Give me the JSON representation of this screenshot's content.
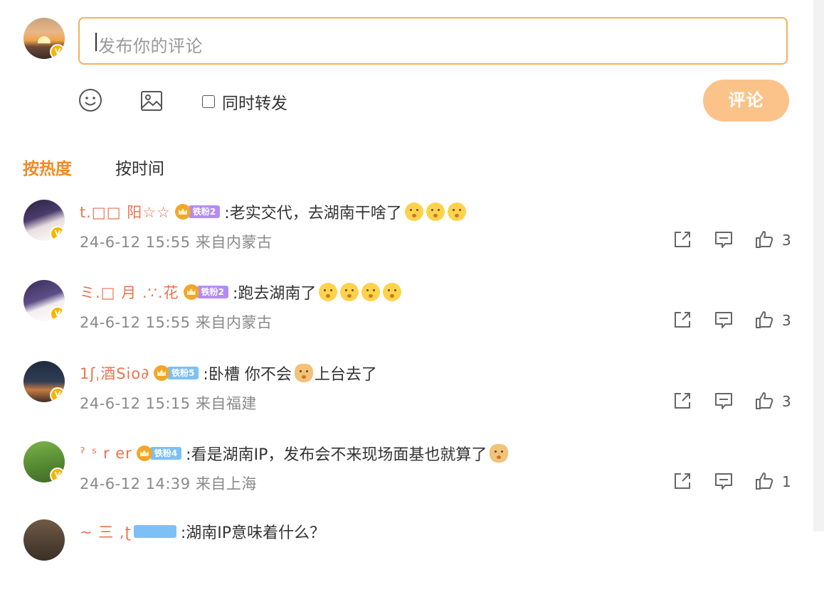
{
  "composer": {
    "placeholder": "发布你的评论",
    "repost_label": "同时转发",
    "submit_label": "评论",
    "tools": [
      "emoji-icon",
      "image-icon"
    ]
  },
  "sort_tabs": {
    "hot": "按热度",
    "time": "按时间",
    "active": "hot"
  },
  "colors": {
    "accent": "#f08a24",
    "username": "#eb7350",
    "input_border": "#f6b05a",
    "button": "#fbc38a"
  },
  "comments": [
    {
      "username": "t.□□ 阳☆☆",
      "level_badge": "铁粉2",
      "level_color": "purple",
      "text": ":老实交代，去湖南干啥了",
      "emoji_count": 3,
      "date": "24-6-12 15:55",
      "location": "来自内蒙古",
      "likes": "3"
    },
    {
      "username": "ミ.□ 月 .∵.花",
      "level_badge": "铁粉2",
      "level_color": "purple",
      "text": ":跑去湖南了",
      "emoji_count": 4,
      "date": "24-6-12 15:55",
      "location": "来自内蒙古",
      "likes": "3"
    },
    {
      "username": "1ʃˌ酒Sio∂",
      "level_badge": "铁粉5",
      "level_color": "blue",
      "text": ":卧槽 你不会",
      "text_after": "上台去了",
      "date": "24-6-12 15:15",
      "location": "来自福建",
      "likes": "3"
    },
    {
      "username": "ˀ ˢ r er",
      "level_badge": "铁粉4",
      "level_color": "blue",
      "text": ":看是湖南IP，发布会不来现场面基也就算了",
      "date": "24-6-12 14:39",
      "location": "来自上海",
      "likes": "1"
    },
    {
      "username": "~ 三 ,ʈ",
      "level_badge": "",
      "level_color": "blue",
      "text": ":湖南IP意味着什么？"
    }
  ]
}
